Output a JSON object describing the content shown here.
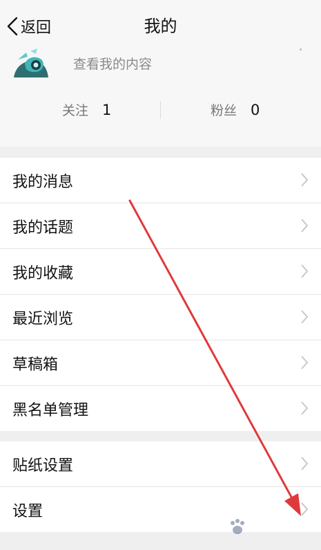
{
  "header": {
    "back_label": "返回",
    "title": "我的"
  },
  "profile": {
    "view_content": "查看我的内容",
    "following_label": "关注",
    "following_count": "1",
    "followers_label": "粉丝",
    "followers_count": "0"
  },
  "menu_group_1": [
    {
      "label": "我的消息"
    },
    {
      "label": "我的话题"
    },
    {
      "label": "我的收藏"
    },
    {
      "label": "最近浏览"
    },
    {
      "label": "草稿箱"
    },
    {
      "label": "黑名单管理"
    }
  ],
  "menu_group_2": [
    {
      "label": "贴纸设置"
    },
    {
      "label": "设置"
    }
  ],
  "colors": {
    "annotation_arrow": "#e0393b",
    "chevron": "#c8c8c8"
  },
  "icons": {
    "back": "chevron-left-icon",
    "row_arrow": "chevron-right-icon",
    "watermark_logo": "paw-logo"
  }
}
